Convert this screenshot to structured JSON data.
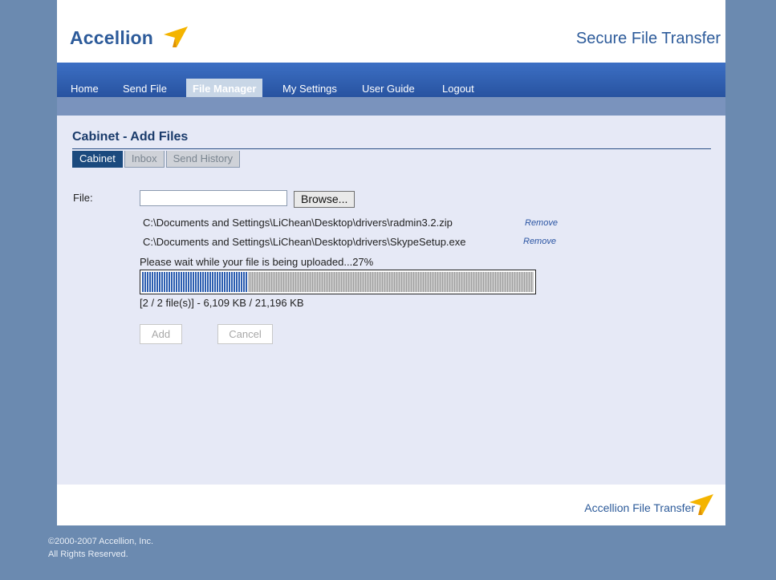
{
  "header": {
    "brand": "Accellion",
    "tagline": "Secure File Transfer"
  },
  "nav": {
    "items": [
      {
        "label": "Home"
      },
      {
        "label": "Send File"
      },
      {
        "label": "File Manager"
      },
      {
        "label": "My Settings"
      },
      {
        "label": "User Guide"
      },
      {
        "label": "Logout"
      }
    ],
    "active": "File Manager"
  },
  "page": {
    "title": "Cabinet - Add Files",
    "tabs": [
      {
        "label": "Cabinet"
      },
      {
        "label": "Inbox"
      },
      {
        "label": "Send History"
      }
    ],
    "active_tab": "Cabinet"
  },
  "form": {
    "file_label": "File:",
    "file_value": "",
    "browse_label": "Browse...",
    "files": [
      {
        "path": "C:\\Documents and Settings\\LiChean\\Desktop\\drivers\\radmin3.2.zip",
        "remove_label": "Remove"
      },
      {
        "path": "C:\\Documents and Settings\\LiChean\\Desktop\\drivers\\SkypeSetup.exe",
        "remove_label": "Remove"
      }
    ],
    "upload_status": "Please wait while your file is being uploaded...27%",
    "progress_fraction": 0.27,
    "counter": "[2 / 2 file(s)] - 6,109 KB / 21,196 KB",
    "add_label": "Add",
    "cancel_label": "Cancel"
  },
  "footer": {
    "brand": "Accellion File Transfer",
    "copyright_line1": "©2000-2007 Accellion, Inc.",
    "copyright_line2": "All Rights Reserved."
  },
  "colors": {
    "accent": "#2d5b9a",
    "nav_bg": "#2853a0",
    "logo_mark": "#f4b400",
    "progress_fill": "#2b5db0"
  },
  "icons": {
    "brand_mark": "accellion-arrow-icon"
  }
}
